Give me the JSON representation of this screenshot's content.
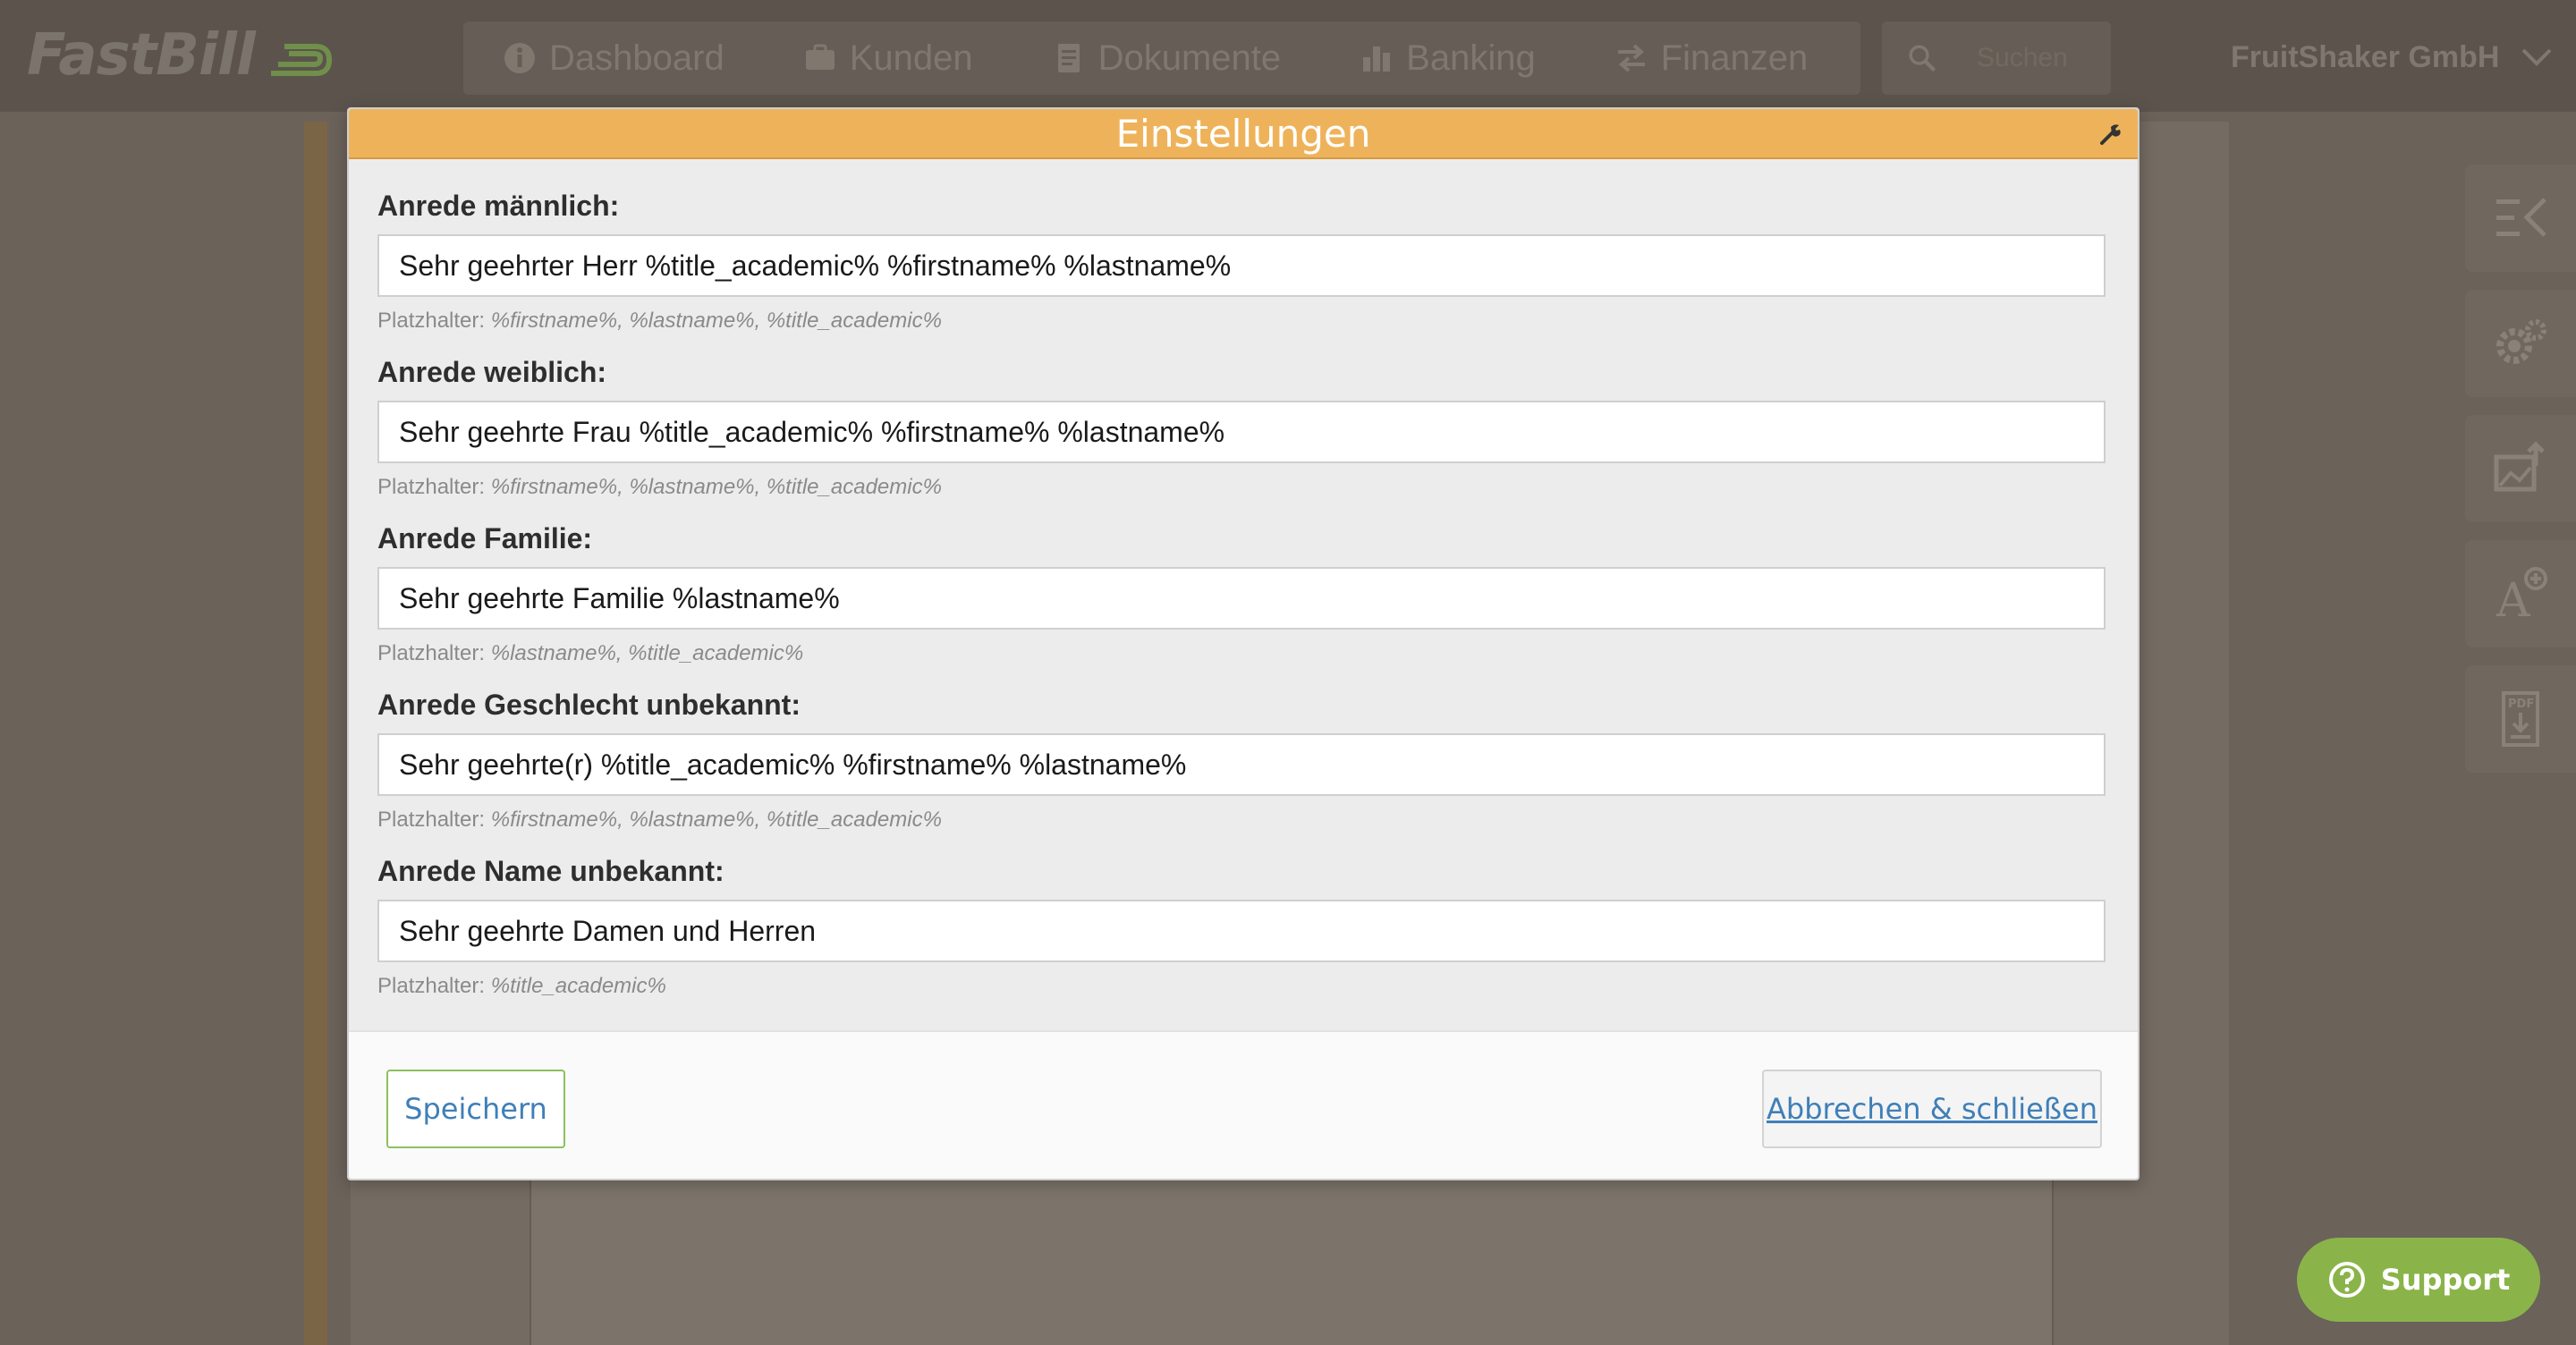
{
  "app": {
    "logo_text": "FastBill",
    "company_name": "FruitShaker GmbH"
  },
  "nav": {
    "items": [
      {
        "label": "Dashboard",
        "icon": "info-icon"
      },
      {
        "label": "Kunden",
        "icon": "briefcase-icon"
      },
      {
        "label": "Dokumente",
        "icon": "document-icon"
      },
      {
        "label": "Banking",
        "icon": "bar-chart-icon"
      },
      {
        "label": "Finanzen",
        "icon": "transfer-arrows-icon"
      }
    ],
    "search_placeholder": "Suchen"
  },
  "modal": {
    "title": "Einstellungen",
    "fields": [
      {
        "label": "Anrede männlich:",
        "value": "Sehr geehrter Herr %title_academic% %firstname% %lastname%",
        "hint_prefix": "Platzhalter:",
        "hint_placeholders": "%firstname%, %lastname%, %title_academic%"
      },
      {
        "label": "Anrede weiblich:",
        "value": "Sehr geehrte Frau %title_academic% %firstname% %lastname%",
        "hint_prefix": "Platzhalter:",
        "hint_placeholders": "%firstname%, %lastname%, %title_academic%"
      },
      {
        "label": "Anrede Familie:",
        "value": "Sehr geehrte Familie %lastname%",
        "hint_prefix": "Platzhalter:",
        "hint_placeholders": "%lastname%, %title_academic%"
      },
      {
        "label": "Anrede Geschlecht unbekannt:",
        "value": "Sehr geehrte(r) %title_academic% %firstname% %lastname%",
        "hint_prefix": "Platzhalter:",
        "hint_placeholders": "%firstname%, %lastname%, %title_academic%"
      },
      {
        "label": "Anrede Name unbekannt:",
        "value": "Sehr geehrte Damen und Herren",
        "hint_prefix": "Platzhalter:",
        "hint_placeholders": "%title_academic%"
      }
    ],
    "save_label": "Speichern",
    "cancel_label": "Abbrechen & schließen"
  },
  "right_tools": [
    {
      "icon": "collapse-menu-icon"
    },
    {
      "icon": "gears-icon"
    },
    {
      "icon": "image-upload-icon"
    },
    {
      "icon": "add-font-icon"
    },
    {
      "icon": "pdf-download-icon"
    }
  ],
  "support": {
    "label": "Support",
    "icon": "question-circle-icon"
  },
  "colors": {
    "modal_header": "#eeb35a",
    "save_border": "#8cc15d",
    "link_blue": "#3f7fb8",
    "support_green": "#8ab44a",
    "overlay_bg": "#6b625a"
  }
}
